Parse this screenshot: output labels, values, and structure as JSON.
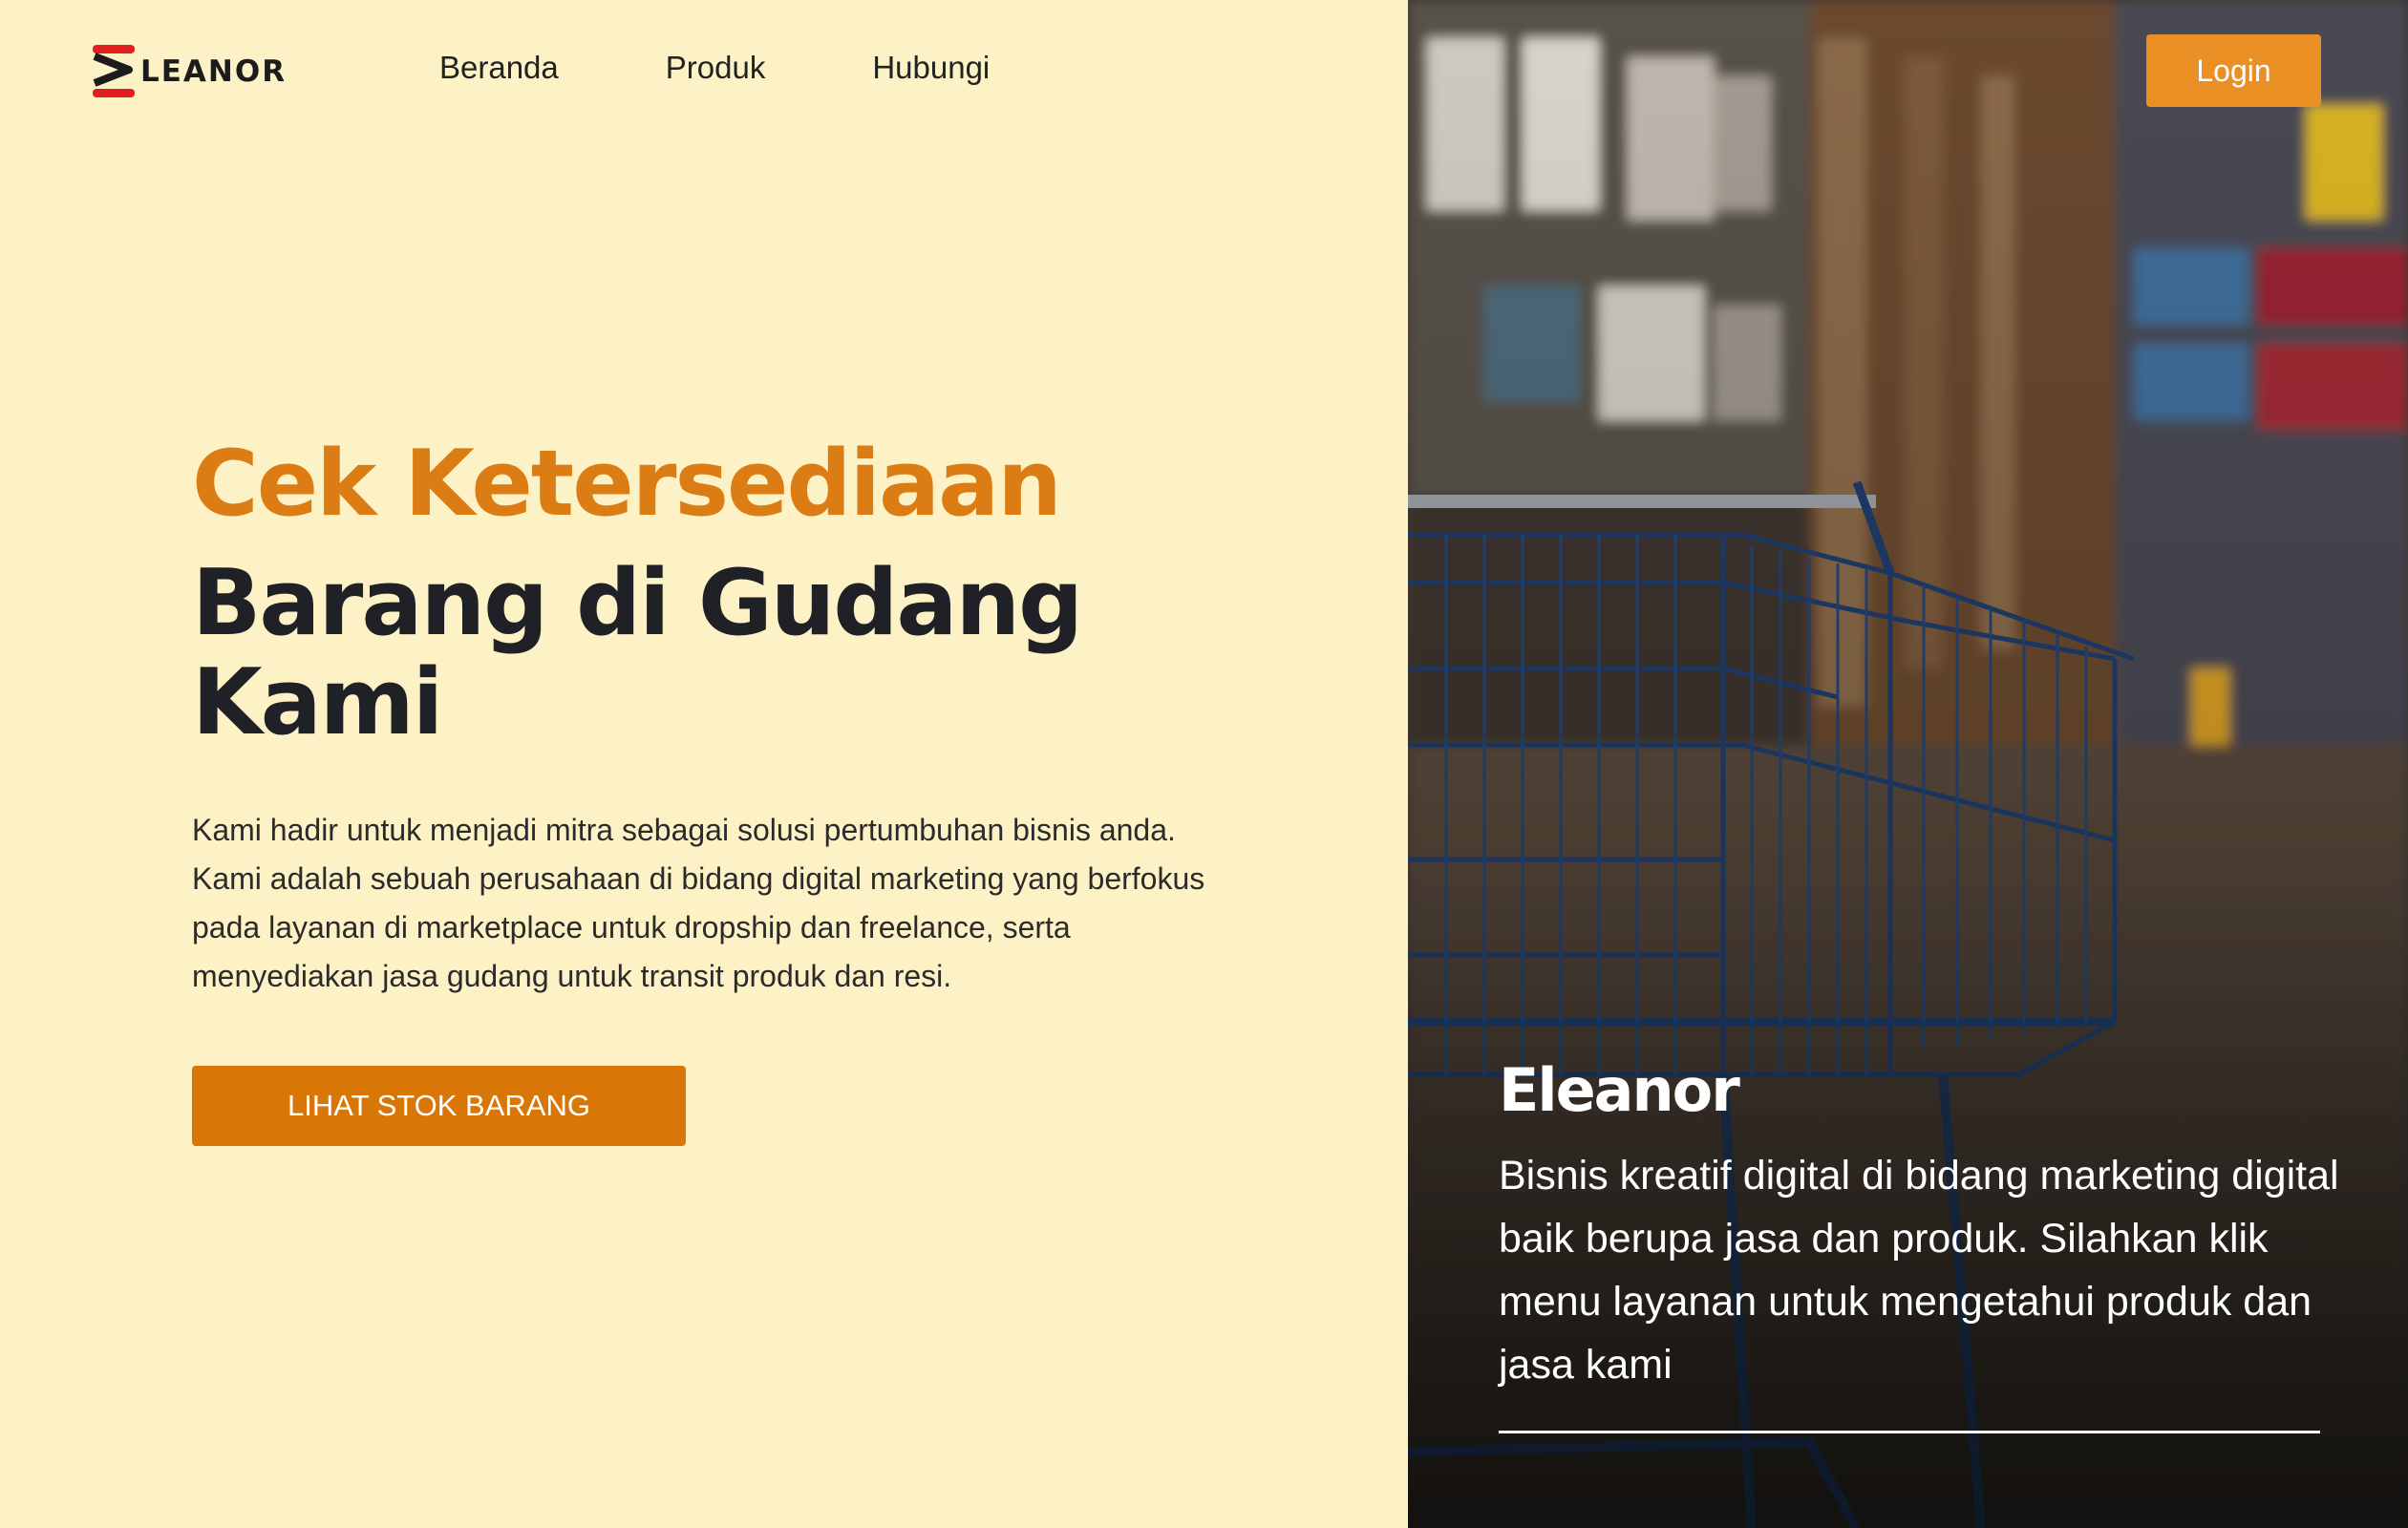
{
  "brand": {
    "name": "LEANOR",
    "accent_color": "#e21f1f"
  },
  "nav": {
    "items": [
      {
        "label": "Beranda"
      },
      {
        "label": "Produk"
      },
      {
        "label": "Hubungi"
      }
    ]
  },
  "header": {
    "login_label": "Login"
  },
  "hero": {
    "title_line1": "Cek Ketersediaan",
    "title_line2": "Barang di Gudang Kami",
    "description": "Kami hadir untuk menjadi mitra sebagai solusi pertumbuhan bisnis anda. Kami adalah sebuah perusahaan di bidang digital marketing yang berfokus pada layanan di marketplace untuk dropship dan freelance, serta menyediakan jasa gudang untuk transit produk dan resi.",
    "cta_label": "LIHAT STOK BARANG"
  },
  "side_panel": {
    "title": "Eleanor",
    "description": "Bisnis kreatif digital di bidang marketing digital baik berupa jasa dan produk. Silahkan klik menu layanan untuk mengetahui produk dan jasa kami",
    "image": "warehouse-shopping-cart-photo"
  },
  "colors": {
    "background": "#fdf2c6",
    "accent_orange": "#dc7c14",
    "button_orange": "#d87608",
    "login_orange": "#ea8f23",
    "dark_text": "#1f2126"
  }
}
